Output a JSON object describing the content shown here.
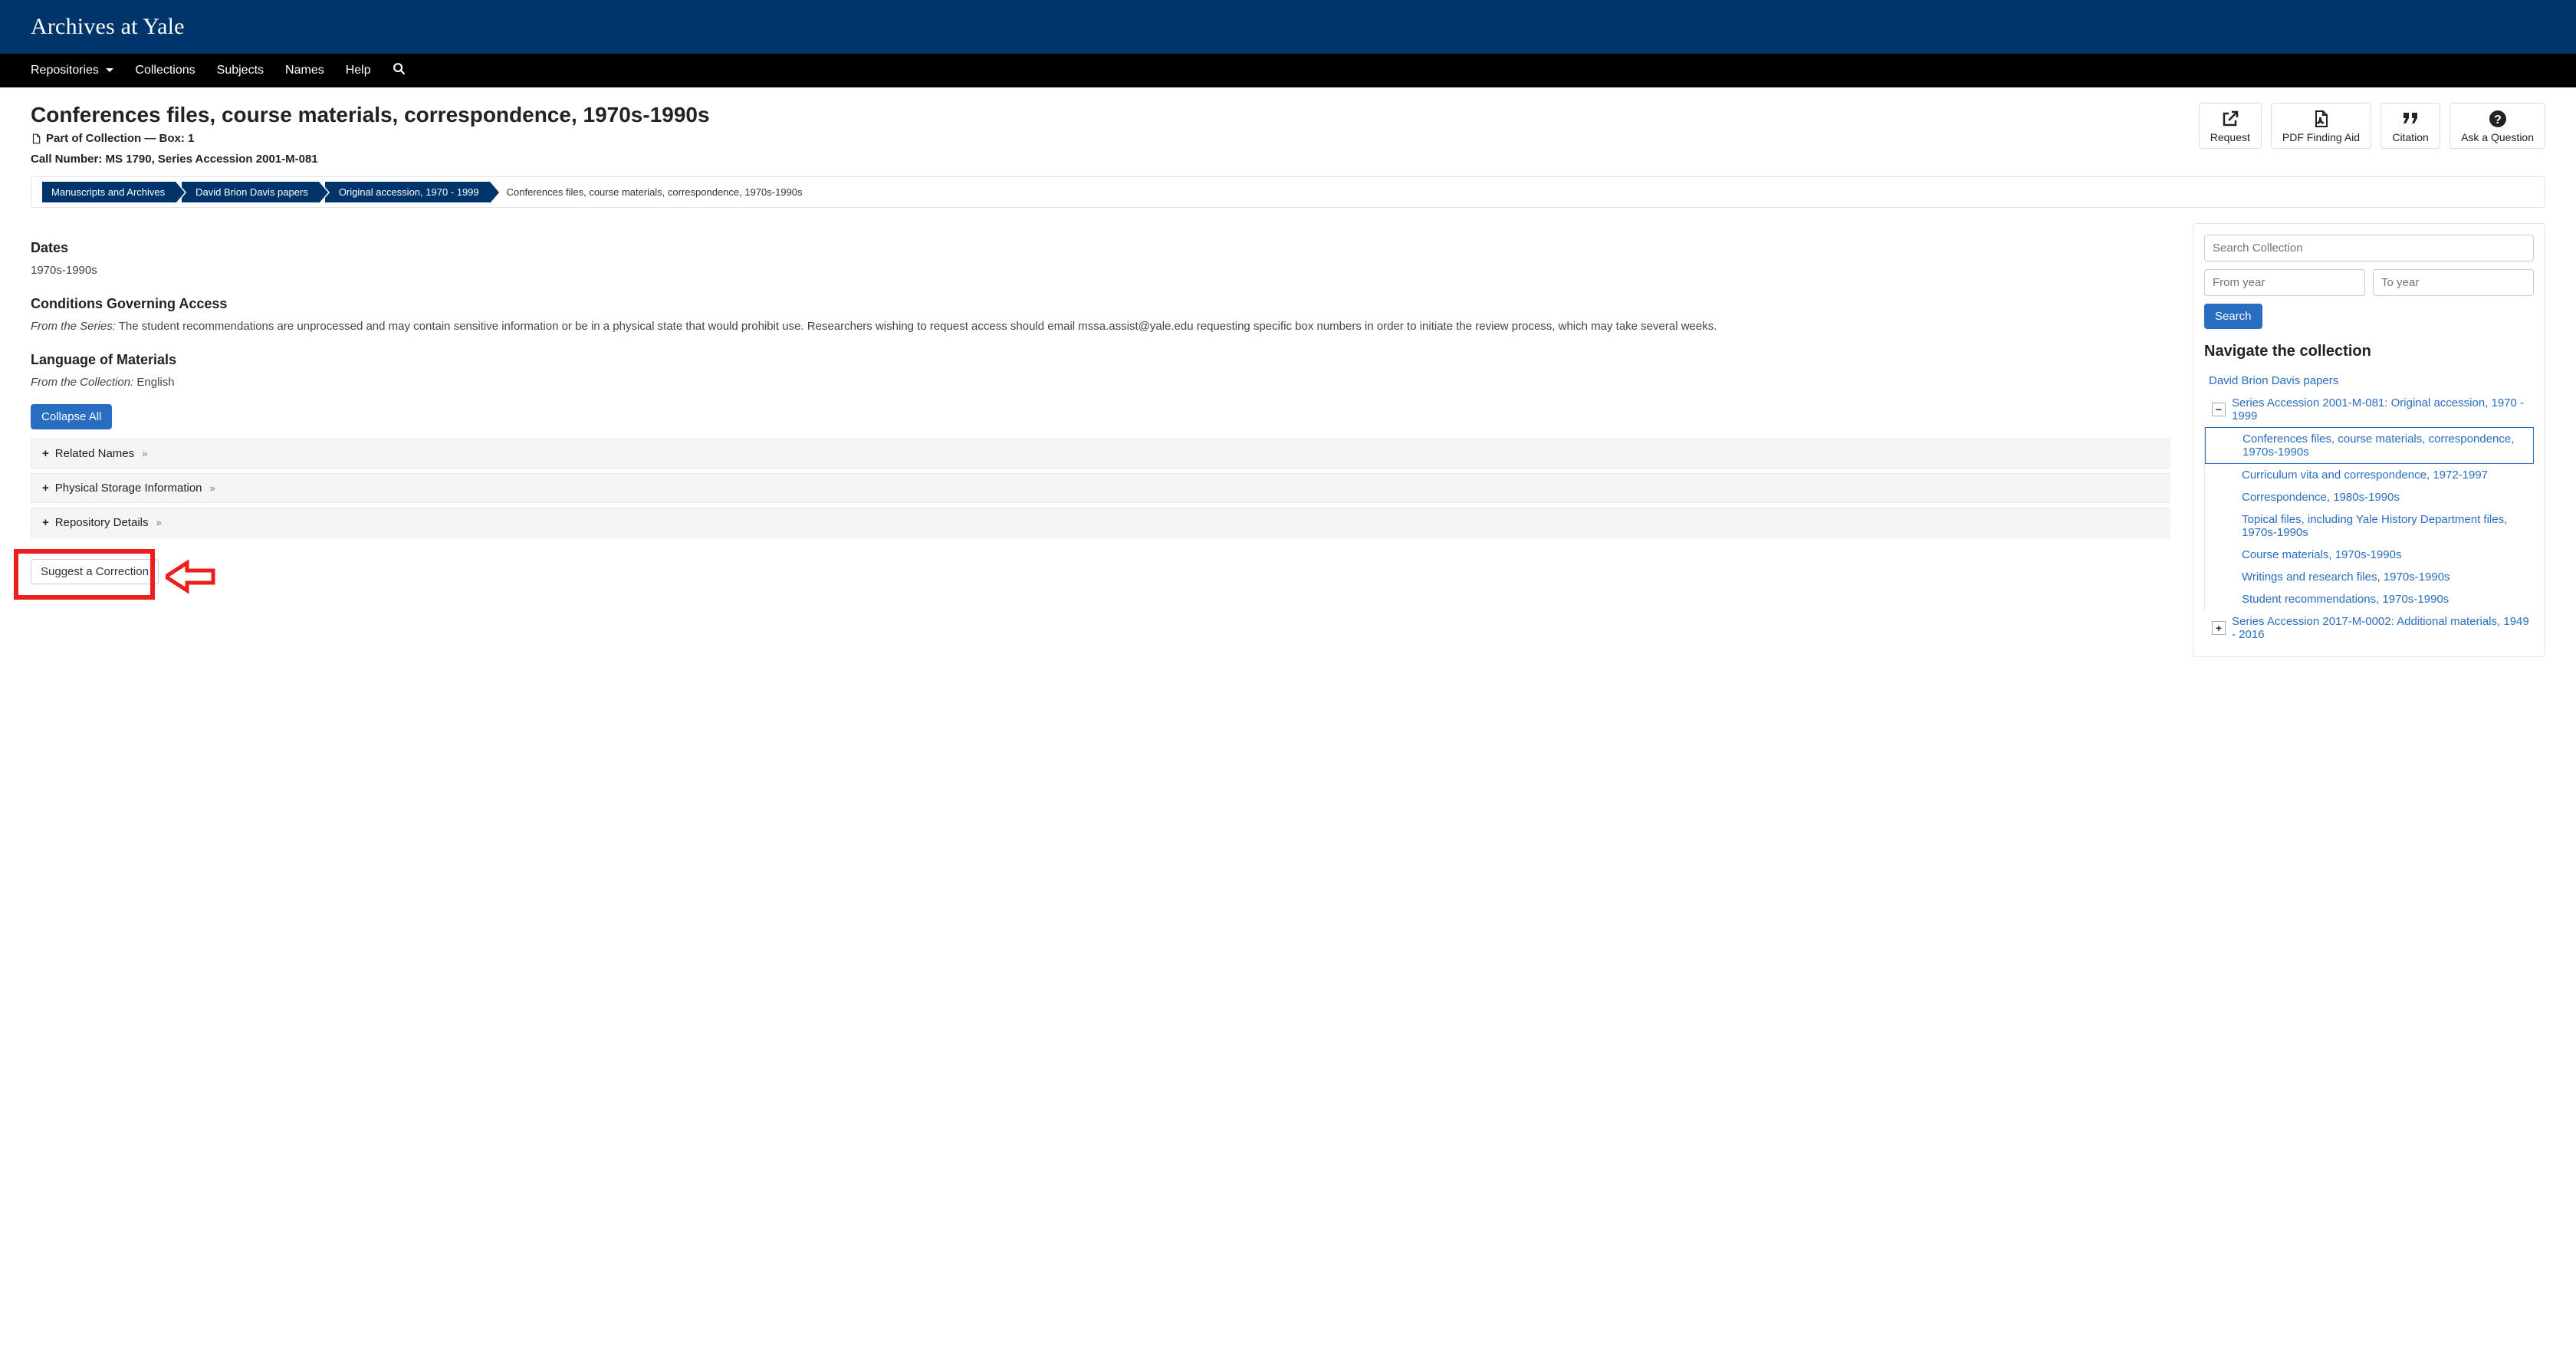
{
  "header": {
    "site_title": "Archives at Yale"
  },
  "nav": {
    "repositories": "Repositories",
    "collections": "Collections",
    "subjects": "Subjects",
    "names": "Names",
    "help": "Help"
  },
  "page_title": "Conferences files, course materials, correspondence, 1970s-1990s",
  "subtitle": "Part of Collection — Box: 1",
  "call_number": {
    "label": "Call Number:",
    "value": "MS 1790, Series Accession 2001-M-081"
  },
  "actions": {
    "request": "Request",
    "pdf": "PDF Finding Aid",
    "citation": "Citation",
    "ask": "Ask a Question"
  },
  "breadcrumbs": {
    "b1": "Manuscripts and Archives",
    "b2": "David Brion Davis papers",
    "b3": "Original accession, 1970 - 1999",
    "tail": "Conferences files, course materials, correspondence, 1970s-1990s"
  },
  "sections": {
    "dates_h": "Dates",
    "dates_v": "1970s-1990s",
    "cond_h": "Conditions Governing Access",
    "cond_prefix": "From the Series:",
    "cond_body": " The student recommendations are unprocessed and may contain sensitive information or be in a physical state that would prohibit use. Researchers wishing to request access should email mssa.assist@yale.edu requesting specific box numbers in order to initiate the review process, which may take several weeks.",
    "lang_h": "Language of Materials",
    "lang_prefix": "From the Collection:",
    "lang_body": " English",
    "collapse_btn": "Collapse All",
    "acc1": "Related Names",
    "acc2": "Physical Storage Information",
    "acc3": "Repository Details",
    "suggest": "Suggest a Correction"
  },
  "sidebar": {
    "search_placeholder": "Search Collection",
    "from_placeholder": "From year",
    "to_placeholder": "To year",
    "search_btn": "Search",
    "nav_h": "Navigate the collection",
    "root": "David Brion Davis papers",
    "series1": "Series Accession 2001-M-081: Original accession, 1970 - 1999",
    "items": [
      "Conferences files, course materials, correspondence, 1970s-1990s",
      "Curriculum vita and correspondence, 1972-1997",
      "Correspondence, 1980s-1990s",
      "Topical files, including Yale History Department files, 1970s-1990s",
      "Course materials, 1970s-1990s",
      "Writings and research files, 1970s-1990s",
      "Student recommendations, 1970s-1990s"
    ],
    "series2": "Series Accession 2017-M-0002: Additional materials, 1949 - 2016"
  }
}
